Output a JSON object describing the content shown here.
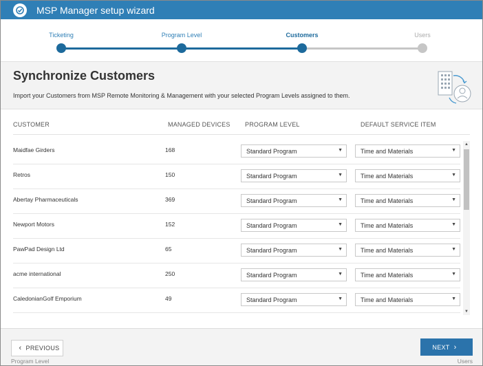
{
  "window": {
    "title": "MSP Manager setup wizard",
    "icon": "msp-gear-icon"
  },
  "colors": {
    "accent": "#2f7fb6",
    "step_active": "#1d6a9c",
    "step_inactive": "#c6c6c6"
  },
  "stepper": {
    "steps": [
      {
        "label": "Ticketing",
        "state": "complete"
      },
      {
        "label": "Program Level",
        "state": "complete"
      },
      {
        "label": "Customers",
        "state": "current"
      },
      {
        "label": "Users",
        "state": "upcoming"
      }
    ]
  },
  "header": {
    "title": "Synchronize Customers",
    "description": "Import your Customers from MSP Remote Monitoring & Management with your selected Program Levels assigned to them."
  },
  "table": {
    "columns": [
      "CUSTOMER",
      "MANAGED DEVICES",
      "PROGRAM LEVEL",
      "DEFAULT SERVICE ITEM"
    ],
    "rows": [
      {
        "customer": "Maidfae Girders",
        "devices": "168",
        "program": "Standard Program",
        "service": "Time and Materials"
      },
      {
        "customer": "Retros",
        "devices": "150",
        "program": "Standard Program",
        "service": "Time and Materials"
      },
      {
        "customer": "Abertay Pharmaceuticals",
        "devices": "369",
        "program": "Standard Program",
        "service": "Time and Materials"
      },
      {
        "customer": "Newport Motors",
        "devices": "152",
        "program": "Standard Program",
        "service": "Time and Materials"
      },
      {
        "customer": "PawPad Design Ltd",
        "devices": "65",
        "program": "Standard Program",
        "service": "Time and Materials"
      },
      {
        "customer": "acme international",
        "devices": "250",
        "program": "Standard Program",
        "service": "Time and Materials"
      },
      {
        "customer": "CaledonianGolf Emporium",
        "devices": "49",
        "program": "Standard Program",
        "service": "Time and Materials"
      }
    ]
  },
  "footer": {
    "previous_label": "PREVIOUS",
    "next_label": "NEXT",
    "previous_step": "Program Level",
    "next_step": "Users"
  }
}
